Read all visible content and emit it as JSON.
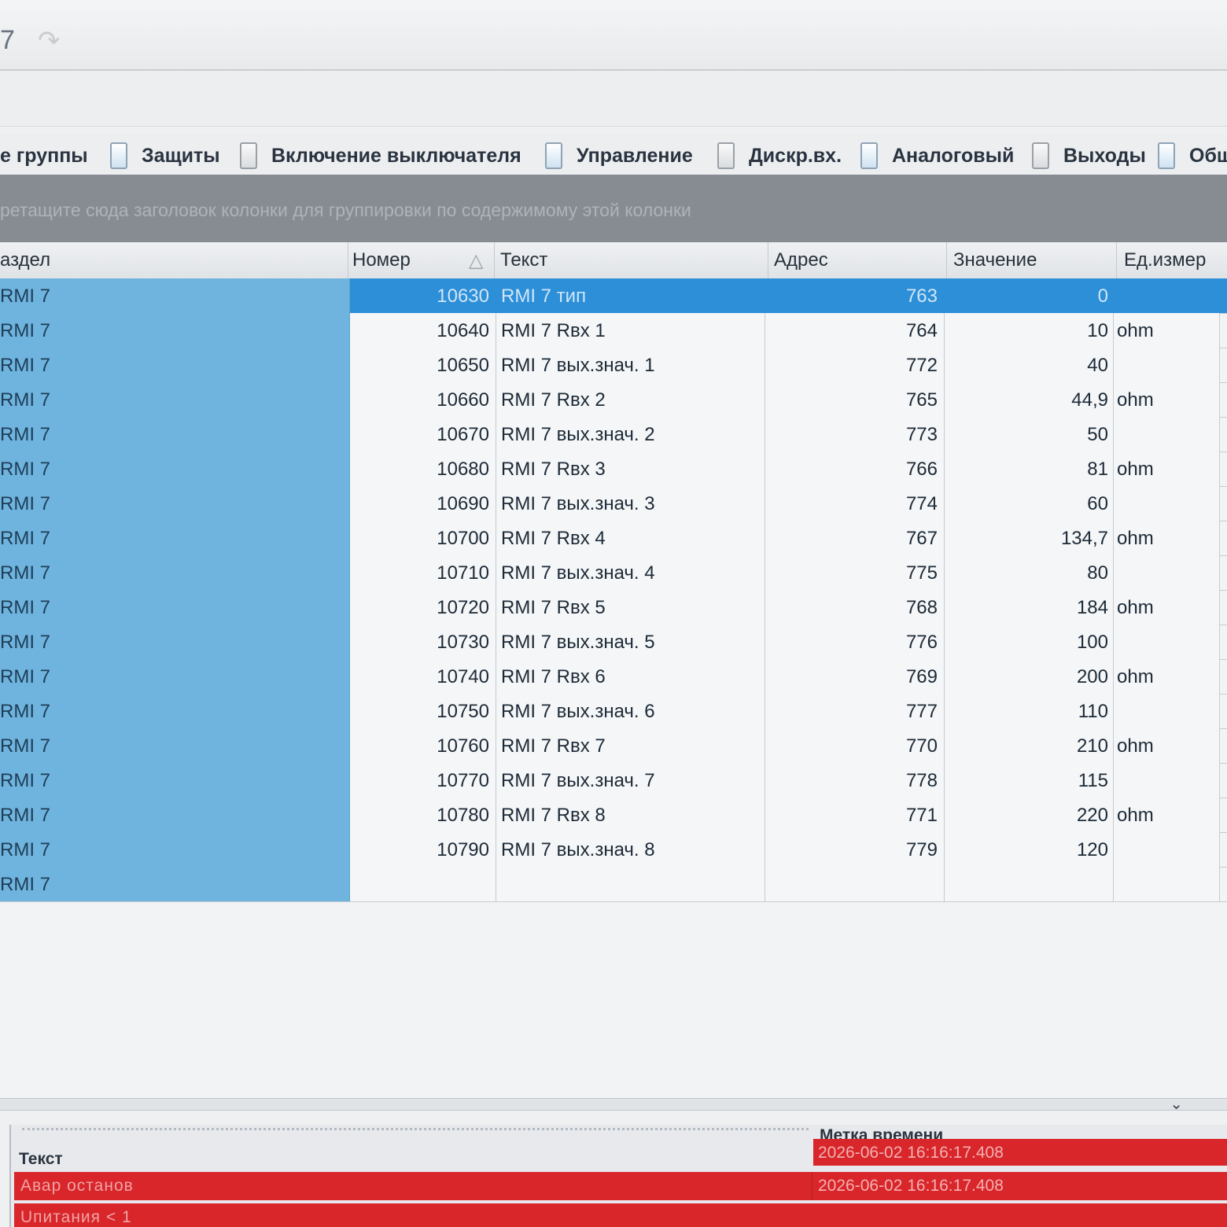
{
  "toolbar": {
    "title_fragment": "7"
  },
  "filters": [
    {
      "label": "е группы",
      "checkbox": false
    },
    {
      "label": "Защиты",
      "checkbox": true
    },
    {
      "label": "Включение выключателя",
      "checkbox": true
    },
    {
      "label": "Управление",
      "checkbox": true
    },
    {
      "label": "Дискр.вх.",
      "checkbox": true
    },
    {
      "label": "Аналоговый",
      "checkbox": true
    },
    {
      "label": "Выходы",
      "checkbox": true
    },
    {
      "label": "Общ",
      "checkbox": true
    }
  ],
  "group_panel": {
    "hint": "ретащите сюда заголовок колонки для группировки по содержимому этой колонки"
  },
  "grid": {
    "columns": {
      "razdel": "аздел",
      "nomer": "Номер",
      "tekst": "Текст",
      "adres": "Адрес",
      "znachenie": "Значение",
      "ed_izmer": "Ед.измер"
    },
    "sort_indicator": "△",
    "rows": [
      {
        "razdel": "RMI 7",
        "nomer": "10630",
        "tekst": "RMI 7 тип",
        "adres": "763",
        "znachenie": "0",
        "ed": ""
      },
      {
        "razdel": "RMI 7",
        "nomer": "10640",
        "tekst": "RMI 7 Rвх 1",
        "adres": "764",
        "znachenie": "10",
        "ed": "ohm"
      },
      {
        "razdel": "RMI 7",
        "nomer": "10650",
        "tekst": "RMI 7 вых.знач. 1",
        "adres": "772",
        "znachenie": "40",
        "ed": ""
      },
      {
        "razdel": "RMI 7",
        "nomer": "10660",
        "tekst": "RMI 7 Rвх 2",
        "adres": "765",
        "znachenie": "44,9",
        "ed": "ohm"
      },
      {
        "razdel": "RMI 7",
        "nomer": "10670",
        "tekst": "RMI 7 вых.знач. 2",
        "adres": "773",
        "znachenie": "50",
        "ed": ""
      },
      {
        "razdel": "RMI 7",
        "nomer": "10680",
        "tekst": "RMI 7 Rвх 3",
        "adres": "766",
        "znachenie": "81",
        "ed": "ohm"
      },
      {
        "razdel": "RMI 7",
        "nomer": "10690",
        "tekst": "RMI 7 вых.знач. 3",
        "adres": "774",
        "znachenie": "60",
        "ed": ""
      },
      {
        "razdel": "RMI 7",
        "nomer": "10700",
        "tekst": "RMI 7 Rвх 4",
        "adres": "767",
        "znachenie": "134,7",
        "ed": "ohm"
      },
      {
        "razdel": "RMI 7",
        "nomer": "10710",
        "tekst": "RMI 7 вых.знач. 4",
        "adres": "775",
        "znachenie": "80",
        "ed": ""
      },
      {
        "razdel": "RMI 7",
        "nomer": "10720",
        "tekst": "RMI 7 Rвх 5",
        "adres": "768",
        "znachenie": "184",
        "ed": "ohm"
      },
      {
        "razdel": "RMI 7",
        "nomer": "10730",
        "tekst": "RMI 7 вых.знач. 5",
        "adres": "776",
        "znachenie": "100",
        "ed": ""
      },
      {
        "razdel": "RMI 7",
        "nomer": "10740",
        "tekst": "RMI 7 Rвх 6",
        "adres": "769",
        "znachenie": "200",
        "ed": "ohm"
      },
      {
        "razdel": "RMI 7",
        "nomer": "10750",
        "tekst": "RMI 7 вых.знач. 6",
        "adres": "777",
        "znachenie": "110",
        "ed": ""
      },
      {
        "razdel": "RMI 7",
        "nomer": "10760",
        "tekst": "RMI 7 Rвх 7",
        "adres": "770",
        "znachenie": "210",
        "ed": "ohm"
      },
      {
        "razdel": "RMI 7",
        "nomer": "10770",
        "tekst": "RMI 7 вых.знач. 7",
        "adres": "778",
        "znachenie": "115",
        "ed": ""
      },
      {
        "razdel": "RMI 7",
        "nomer": "10780",
        "tekst": "RMI 7 Rвх 8",
        "adres": "771",
        "znachenie": "220",
        "ed": "ohm"
      },
      {
        "razdel": "RMI 7",
        "nomer": "10790",
        "tekst": "RMI 7 вых.знач. 8",
        "adres": "779",
        "znachenie": "120",
        "ed": ""
      },
      {
        "razdel": "RMI 7",
        "nomer": "",
        "tekst": "",
        "adres": "",
        "znachenie": "",
        "ed": ""
      }
    ]
  },
  "alarm_panel": {
    "headers": {
      "text": "Текст",
      "timestamp": "Метка времени"
    },
    "rows": [
      {
        "text": "Авар останов",
        "timestamp": "2026-06-02 16:16:17.408"
      },
      {
        "text": "Uпитания < 1",
        "timestamp": ""
      }
    ],
    "top_timestamp": "2026-06-02 16:16:17.408",
    "color": "#d8262a"
  },
  "colors": {
    "selected_row": "#2d8fd8",
    "razdel_column": "#6fb4df",
    "group_panel": "#878c93"
  }
}
